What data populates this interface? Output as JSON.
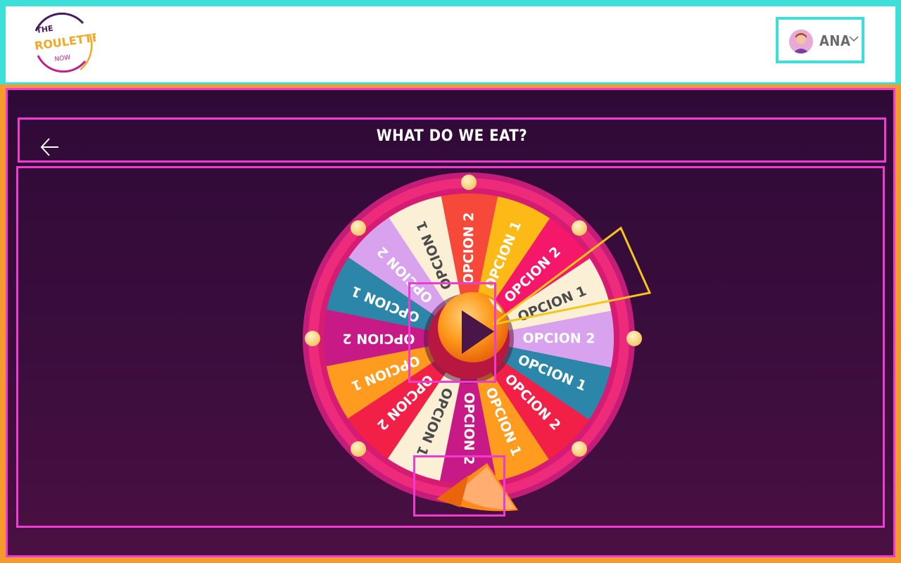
{
  "header": {
    "logo": {
      "line1": "THE",
      "line2": "ROULETTE",
      "line3": "NOW"
    },
    "user": {
      "name": "ANA",
      "avatar_icon": "user-avatar-icon",
      "menu_icon": "chevron-down-icon"
    }
  },
  "page": {
    "title": "WHAT DO WE EAT?",
    "back_icon": "arrow-left-icon"
  },
  "wheel": {
    "segments": [
      {
        "label": "OPCION 2",
        "color": "#f6493a",
        "text": "#ffffff"
      },
      {
        "label": "OPCION 1",
        "color": "#fdb915",
        "text": "#ffffff"
      },
      {
        "label": "OPCION 2",
        "color": "#f4176a",
        "text": "#ffffff"
      },
      {
        "label": "OPCION 1",
        "color": "#fbf0d5",
        "text": "#4b4b4b"
      },
      {
        "label": "OPCION 2",
        "color": "#d9a2ee",
        "text": "#ffffff"
      },
      {
        "label": "OPCION 1",
        "color": "#2c86aa",
        "text": "#ffffff"
      },
      {
        "label": "OPCION 2",
        "color": "#f21f47",
        "text": "#ffffff"
      },
      {
        "label": "OPCION 1",
        "color": "#ff9b1f",
        "text": "#ffffff"
      },
      {
        "label": "OPCION 2",
        "color": "#c71a86",
        "text": "#ffffff"
      },
      {
        "label": "OPCION 1",
        "color": "#fbf0d5",
        "text": "#4b4b4b"
      },
      {
        "label": "OPCION 2",
        "color": "#f21f47",
        "text": "#ffffff"
      },
      {
        "label": "OPCION 1",
        "color": "#ff9b1f",
        "text": "#ffffff"
      },
      {
        "label": "OPCION 2",
        "color": "#c71a86",
        "text": "#ffffff"
      },
      {
        "label": "OPCION 1",
        "color": "#2c86aa",
        "text": "#ffffff"
      },
      {
        "label": "OPCION 2",
        "color": "#d9a2ee",
        "text": "#ffffff"
      },
      {
        "label": "OPCION 1",
        "color": "#fbf0d5",
        "text": "#4b4b4b"
      }
    ],
    "spin_icon": "play-icon",
    "pointer_icon": "pointer-icon"
  },
  "colors": {
    "accent_magenta": "#f03bd2",
    "accent_cyan": "#3de0d9",
    "frame_orange": "#f59a2c",
    "background_dark": "#2f0a37",
    "wheel_rim": "#ee2a7b"
  }
}
